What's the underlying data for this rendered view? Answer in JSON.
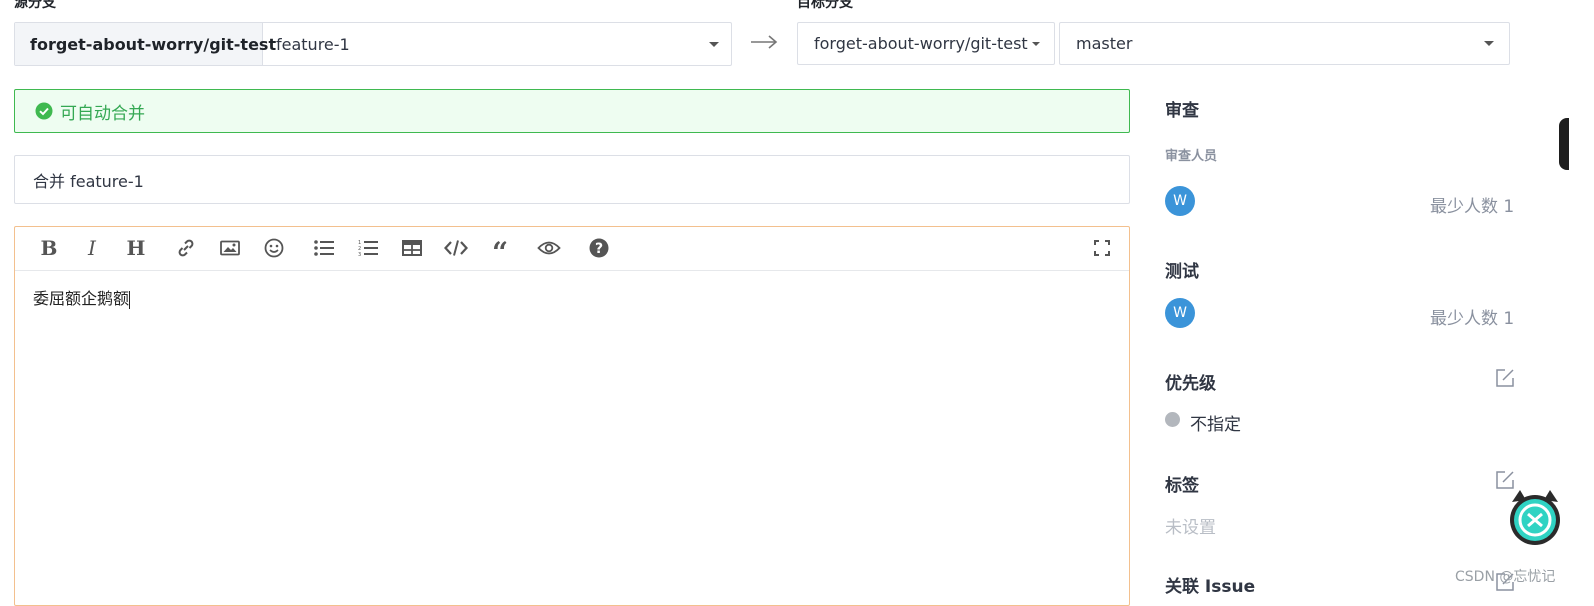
{
  "branches": {
    "source_label": "源分支",
    "source_repo": "forget-about-worry/git-test",
    "source_branch": "feature-1",
    "target_label": "目标分支",
    "target_repo": "forget-about-worry/git-test",
    "target_branch": "master"
  },
  "merge_status": "可自动合并",
  "title_value": "合并 feature-1",
  "editor": {
    "toolbar": [
      "bold",
      "italic",
      "heading",
      "link",
      "image",
      "emoji",
      "unordered-list",
      "ordered-list",
      "table",
      "code",
      "quote",
      "preview",
      "help",
      "fullscreen"
    ],
    "content": "委屈额企鹅额"
  },
  "sidebar": {
    "review_title": "审查",
    "reviewers_label": "审查人员",
    "reviewer_avatar": "W",
    "reviewer_min": "最少人数 1",
    "test_title": "测试",
    "tester_avatar": "W",
    "tester_min": "最少人数 1",
    "priority_title": "优先级",
    "priority_value": "不指定",
    "labels_title": "标签",
    "labels_value": "未设置",
    "issue_title": "关联 Issue"
  },
  "watermark": "CSDN @忘忧记",
  "colors": {
    "success_bg": "#eefdf1",
    "success_border": "#3fb950",
    "success_text": "#34a853",
    "editor_border": "#f3c08e",
    "avatar": "#3b94d9",
    "mascot": "#2fd3c3"
  }
}
